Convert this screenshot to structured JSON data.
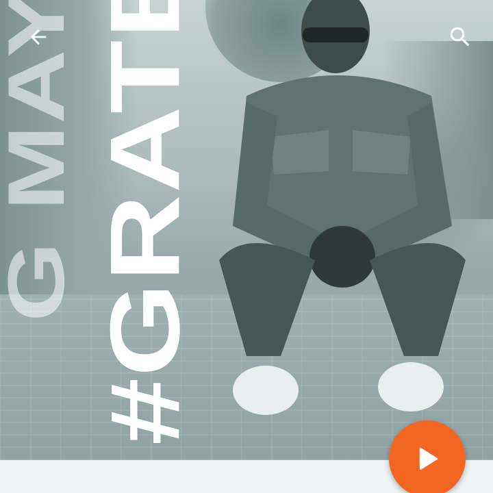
{
  "header": {
    "back_icon": "arrow-back-icon",
    "search_icon": "search-icon"
  },
  "artwork": {
    "artist_name": "G MAYES",
    "hashtag": "#GRATEFUL"
  },
  "player": {
    "play_icon": "play-icon"
  },
  "colors": {
    "accent": "#f26522",
    "background": "#eef3f3",
    "overlay_text": "#ffffff"
  }
}
